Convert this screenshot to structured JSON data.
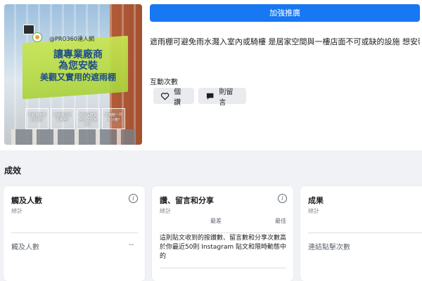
{
  "post": {
    "thumbnail": {
      "brand": "@PRO360達人網",
      "headline_lines": [
        "讓專業廠商",
        "為您安裝",
        "美觀又實用的遮雨棚"
      ],
      "faq": [
        "安裝遮雨棚的優點?",
        "遮雨棚材質有哪些?",
        "如何保障安全大達的差別?",
        "遮雨棚一坪多少錢?"
      ]
    },
    "boost_label": "加強推廣",
    "text": "遮雨棚可避免雨水濺入室內或騎樓 是居家空間與一樓店面不可或缺的設施 想安裝美...",
    "interactions_label": "互動次數",
    "likes_label": "個讚",
    "comments_label": "則留言"
  },
  "results": {
    "title": "成效",
    "cards": [
      {
        "title": "觸及人數",
        "sub": "總計",
        "row_label": "觸及人數",
        "row_value": "--"
      },
      {
        "title": "讚、留言和分享",
        "sub": "總計",
        "scale_low": "最差",
        "scale_high": "最佳",
        "description": "這則貼文收到的按讚數、留言數和分享次數高於你最近50則 Instagram 貼文和限時動態中的"
      },
      {
        "title": "成果",
        "sub": "總計",
        "row_label": "連結點擊次數"
      }
    ]
  },
  "colors": {
    "accent": "#1877f2",
    "pill_bg": "#e9ebee",
    "page_bg": "#f0f2f5"
  },
  "icons": {
    "like": "heart-icon",
    "comment": "speech-bubble-icon",
    "info": "info-icon"
  }
}
